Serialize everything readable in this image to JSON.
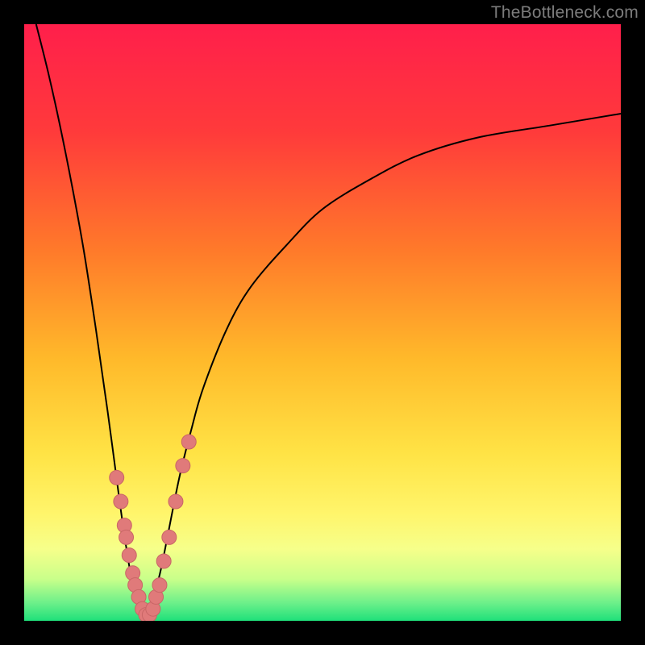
{
  "watermark": "TheBottleneck.com",
  "colors": {
    "bg_black": "#000000",
    "curve": "#000000",
    "dot_fill": "#e07a7a",
    "dot_stroke": "#c96666",
    "gradient_stops": [
      {
        "offset": 0.0,
        "color": "#ff1f4b"
      },
      {
        "offset": 0.18,
        "color": "#ff3a3b"
      },
      {
        "offset": 0.38,
        "color": "#ff7a2a"
      },
      {
        "offset": 0.56,
        "color": "#ffb92a"
      },
      {
        "offset": 0.72,
        "color": "#ffe345"
      },
      {
        "offset": 0.82,
        "color": "#fff56b"
      },
      {
        "offset": 0.88,
        "color": "#f6ff8a"
      },
      {
        "offset": 0.93,
        "color": "#c9ff8a"
      },
      {
        "offset": 0.97,
        "color": "#6cf08a"
      },
      {
        "offset": 1.0,
        "color": "#1fe07a"
      }
    ]
  },
  "chart_data": {
    "type": "line",
    "title": "",
    "xlabel": "",
    "ylabel": "",
    "x_range": [
      0,
      100
    ],
    "y_range_bottleneck_pct": [
      0,
      100
    ],
    "note": "Curve shows bottleneck % (top=100%, bottom=0%). Minimum ~0% at x≈20. Curve left branch starts near top-left; right branch rises toward ~85% at x=100.",
    "series": [
      {
        "name": "bottleneck-curve",
        "x": [
          2,
          4,
          6,
          8,
          10,
          12,
          14,
          16,
          17,
          18,
          19,
          20,
          21,
          22,
          23,
          24,
          26,
          28,
          30,
          34,
          38,
          44,
          50,
          58,
          66,
          76,
          88,
          100
        ],
        "y_bottleneck_pct": [
          100,
          92,
          83,
          73,
          62,
          49,
          35,
          20,
          13,
          7,
          3,
          1,
          2,
          5,
          9,
          14,
          24,
          32,
          39,
          49,
          56,
          63,
          69,
          74,
          78,
          81,
          83,
          85
        ]
      }
    ],
    "dots": {
      "name": "sample-points",
      "comment": "Pink markers clustered near the valley of the curve.",
      "points_x": [
        15.5,
        16.2,
        16.8,
        17.1,
        17.6,
        18.2,
        18.6,
        19.2,
        19.8,
        20.4,
        21.0,
        21.6,
        22.1,
        22.7,
        23.4,
        24.3,
        25.4,
        26.6,
        27.6
      ],
      "points_y_bottleneck_pct": [
        24,
        20,
        16,
        14,
        11,
        8,
        6,
        4,
        2,
        1,
        1,
        2,
        4,
        6,
        10,
        14,
        20,
        26,
        30
      ]
    }
  }
}
